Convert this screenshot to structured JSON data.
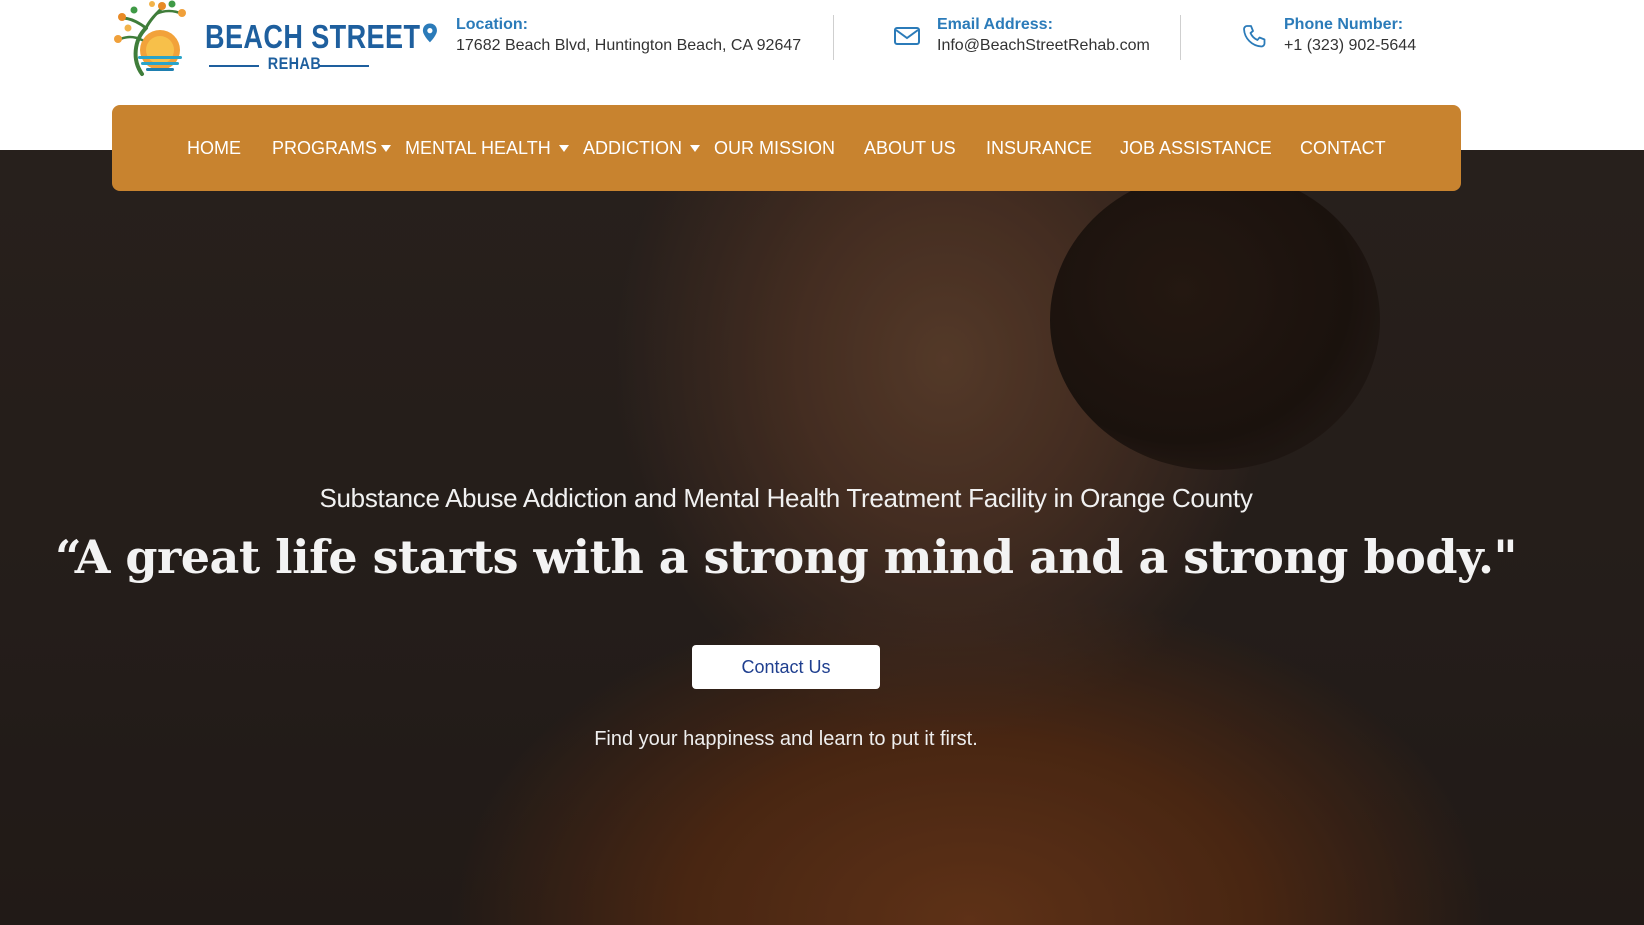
{
  "brand": {
    "line1": "BEACH STREET",
    "line2": "REHAB",
    "colors": {
      "primary": "#1e5f9e",
      "accent_orange": "#e88a26",
      "tree": "#3f7d3a",
      "water": "#2aa4c9"
    }
  },
  "header": {
    "location": {
      "label": "Location:",
      "value": "17682 Beach Blvd, Huntington Beach, CA 92647",
      "icon": "map-pin-icon"
    },
    "email": {
      "label": "Email Address:",
      "value": "Info@BeachStreetRehab.com",
      "icon": "envelope-icon"
    },
    "phone": {
      "label": "Phone Number:",
      "value": "+1 (323) 902-5644",
      "icon": "phone-icon"
    }
  },
  "nav": {
    "background": "#c8832f",
    "items": [
      {
        "label": "HOME",
        "dropdown": false
      },
      {
        "label": "PROGRAMS",
        "dropdown": true
      },
      {
        "label": "MENTAL HEALTH",
        "dropdown": true
      },
      {
        "label": "ADDICTION",
        "dropdown": true
      },
      {
        "label": "OUR MISSION",
        "dropdown": false
      },
      {
        "label": "ABOUT US",
        "dropdown": false
      },
      {
        "label": "INSURANCE",
        "dropdown": false
      },
      {
        "label": "JOB ASSISTANCE",
        "dropdown": false
      },
      {
        "label": "CONTACT",
        "dropdown": false
      }
    ]
  },
  "hero": {
    "subtitle": "Substance Abuse Addiction and Mental Health Treatment Facility in Orange County",
    "quote": "“A great life starts with a strong mind and a strong body.\"",
    "cta_label": "Contact Us",
    "tagline": "Find your happiness and learn to put it first."
  }
}
